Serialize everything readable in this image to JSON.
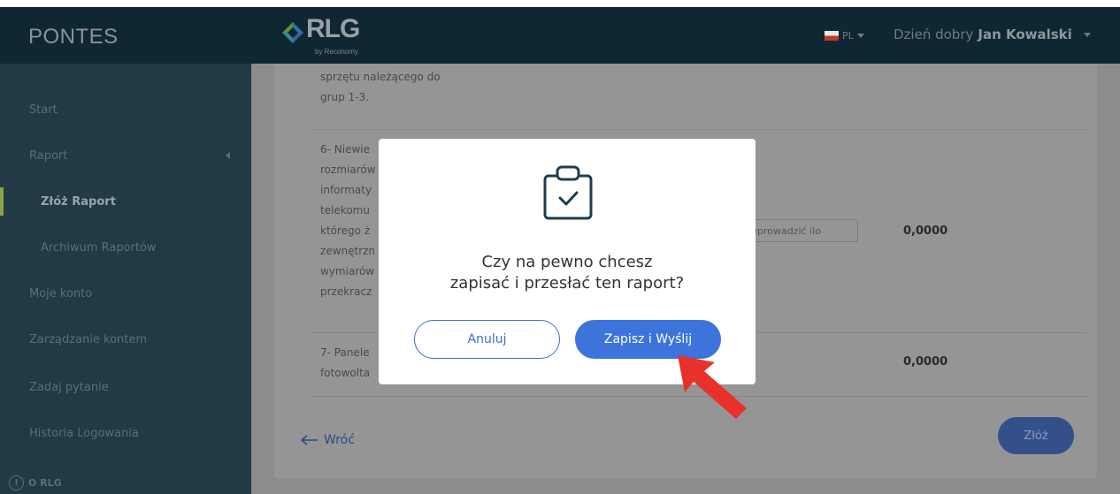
{
  "header": {
    "brand": "PONTES",
    "logo_text": "RLG",
    "logo_sub": "by Reconomy",
    "lang": "PL",
    "greeting_prefix": "Dzień dobry",
    "user_name": "Jan Kowalski"
  },
  "sidebar": {
    "items": [
      {
        "label": "Start"
      },
      {
        "label": "Raport"
      },
      {
        "label": "Złóż Raport"
      },
      {
        "label": "Archiwum Raportów"
      },
      {
        "label": "Moje konto"
      },
      {
        "label": "Zarządzanie kontem"
      },
      {
        "label": "Zadaj pytanie"
      },
      {
        "label": "Historia Logowania"
      }
    ],
    "about": "O RLG"
  },
  "table": {
    "row5_lines": [
      "sprzętu należącego do",
      "grup 1-3."
    ],
    "row6_lines": [
      "6- Niewie",
      "rozmiarów",
      "informaty",
      "telekomu",
      "którego ż",
      "zewnętrzn",
      "wymiarów",
      "przekracz"
    ],
    "row6_input_placeholder": "wprowadzić ilo",
    "row6_value": "0,0000",
    "row7_lines": [
      "7- Panele",
      "fotowolta"
    ],
    "row7_value": "0,0000"
  },
  "footer": {
    "back_label": "Wróć",
    "submit_label": "Złóż"
  },
  "modal": {
    "question_line1": "Czy na pewno chcesz",
    "question_line2": "zapisać i przesłać ten raport?",
    "cancel_label": "Anuluj",
    "confirm_label": "Zapisz i Wyślij"
  },
  "colors": {
    "topbar": "#0f2733",
    "sidebar": "#213a45",
    "primary": "#3d74dc",
    "arrow": "#e8312b"
  }
}
